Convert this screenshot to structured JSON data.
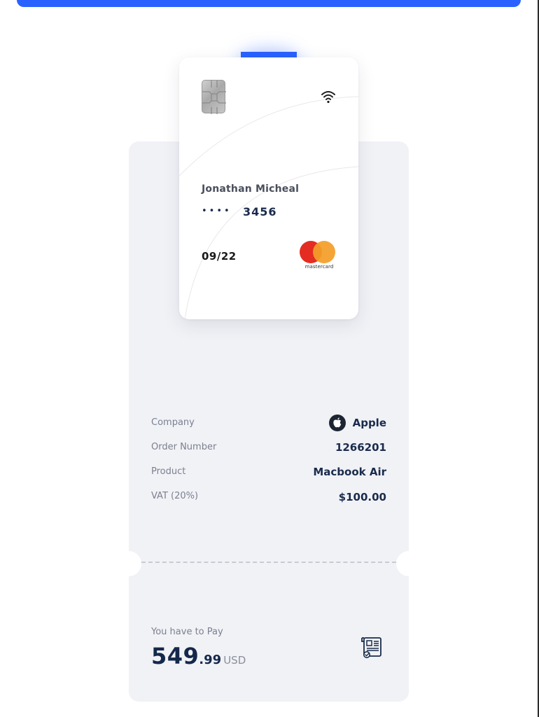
{
  "card": {
    "holder_name": "Jonathan Micheal",
    "masked_dots": "••••",
    "last_digits": "3456",
    "expiry": "09/22",
    "brand": "mastercard"
  },
  "details": {
    "rows": [
      {
        "label": "Company",
        "value": "Apple"
      },
      {
        "label": "Order Number",
        "value": "1266201"
      },
      {
        "label": "Product",
        "value": "Macbook Air"
      },
      {
        "label": "VAT (20%)",
        "value": "$100.00"
      }
    ]
  },
  "payment": {
    "label": "You have to Pay",
    "amount_whole": "549",
    "amount_cents": ".99",
    "currency": "USD"
  },
  "icons": {
    "chip": "card-chip-icon",
    "contactless": "wifi-icon",
    "company": "apple-icon",
    "receipt": "receipt-icon"
  },
  "colors": {
    "accent": "#2962ff",
    "text_dark": "#1a2b4c",
    "panel": "#f1f2f6",
    "mastercard_red": "#e42c22",
    "mastercard_orange": "#f49e29"
  }
}
